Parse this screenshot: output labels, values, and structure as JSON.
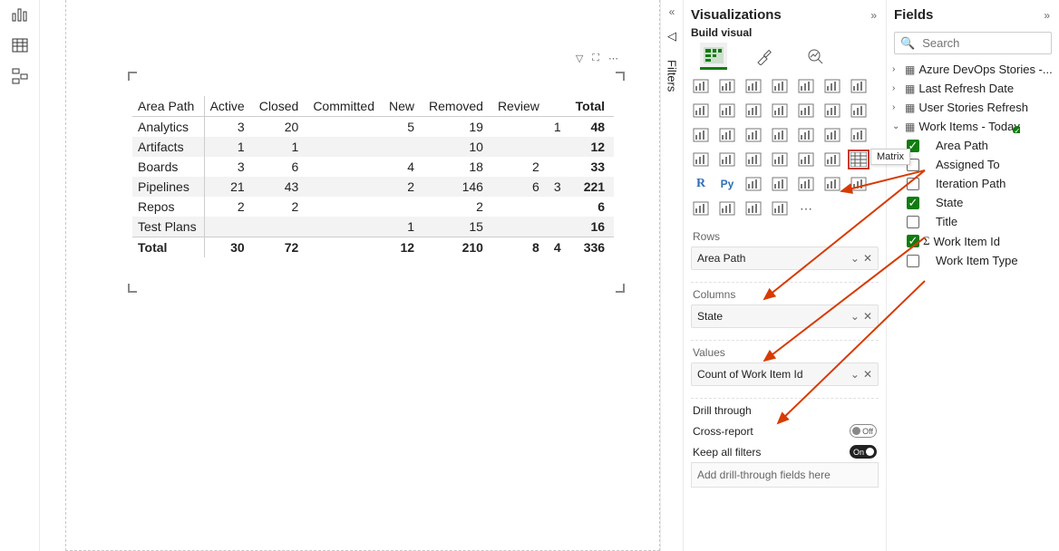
{
  "rail": {
    "icons": [
      "bar-chart-icon",
      "table-icon",
      "model-icon"
    ]
  },
  "filters_label": "Filters",
  "visualizations": {
    "title": "Visualizations",
    "expand_icon": "»",
    "build_label": "Build visual",
    "tooltip": "Matrix",
    "sections": {
      "rows_label": "Rows",
      "rows_value": "Area Path",
      "columns_label": "Columns",
      "columns_value": "State",
      "values_label": "Values",
      "values_value": "Count of Work Item Id",
      "drill_label": "Drill through",
      "cross_report": "Cross-report",
      "cross_report_state": "Off",
      "keep_filters": "Keep all filters",
      "keep_filters_state": "On",
      "drill_placeholder": "Add drill-through fields here"
    }
  },
  "fields": {
    "title": "Fields",
    "search_placeholder": "Search",
    "tables": [
      {
        "name": "Azure DevOps Stories -...",
        "expanded": false
      },
      {
        "name": "Last Refresh Date",
        "expanded": false
      },
      {
        "name": "User Stories Refresh",
        "expanded": false
      },
      {
        "name": "Work Items - Today",
        "expanded": true,
        "checked": true,
        "columns": [
          {
            "name": "Area Path",
            "checked": true
          },
          {
            "name": "Assigned To",
            "checked": false
          },
          {
            "name": "Iteration Path",
            "checked": false
          },
          {
            "name": "State",
            "checked": true
          },
          {
            "name": "Title",
            "checked": false
          },
          {
            "name": "Work Item Id",
            "checked": true,
            "sigma": true
          },
          {
            "name": "Work Item Type",
            "checked": false
          }
        ]
      }
    ]
  },
  "chart_data": {
    "type": "table",
    "row_field": "Area Path",
    "column_field": "State",
    "value_field": "Count of Work Item Id",
    "columns": [
      "Area Path",
      "Active",
      "Closed",
      "Committed",
      "New",
      "Removed",
      "Review",
      "Total"
    ],
    "rows": [
      {
        "Area Path": "Analytics",
        "Active": 3,
        "Closed": 20,
        "Committed": null,
        "New": 5,
        "Removed": 19,
        "Review": null,
        "_trail": 1,
        "Total": 48
      },
      {
        "Area Path": "Artifacts",
        "Active": 1,
        "Closed": 1,
        "Committed": null,
        "New": null,
        "Removed": 10,
        "Review": null,
        "_trail": null,
        "Total": 12
      },
      {
        "Area Path": "Boards",
        "Active": 3,
        "Closed": 6,
        "Committed": null,
        "New": 4,
        "Removed": 18,
        "Review": 2,
        "_trail": null,
        "Total": 33
      },
      {
        "Area Path": "Pipelines",
        "Active": 21,
        "Closed": 43,
        "Committed": null,
        "New": 2,
        "Removed": 146,
        "Review": 6,
        "_trail": 3,
        "Total": 221
      },
      {
        "Area Path": "Repos",
        "Active": 2,
        "Closed": 2,
        "Committed": null,
        "New": null,
        "Removed": 2,
        "Review": null,
        "_trail": null,
        "Total": 6
      },
      {
        "Area Path": "Test Plans",
        "Active": null,
        "Closed": null,
        "Committed": null,
        "New": 1,
        "Removed": 15,
        "Review": null,
        "_trail": null,
        "Total": 16
      }
    ],
    "totals": {
      "Area Path": "Total",
      "Active": 30,
      "Closed": 72,
      "Committed": null,
      "New": 12,
      "Removed": 210,
      "Review": 8,
      "_trail": 4,
      "Total": 336
    }
  }
}
